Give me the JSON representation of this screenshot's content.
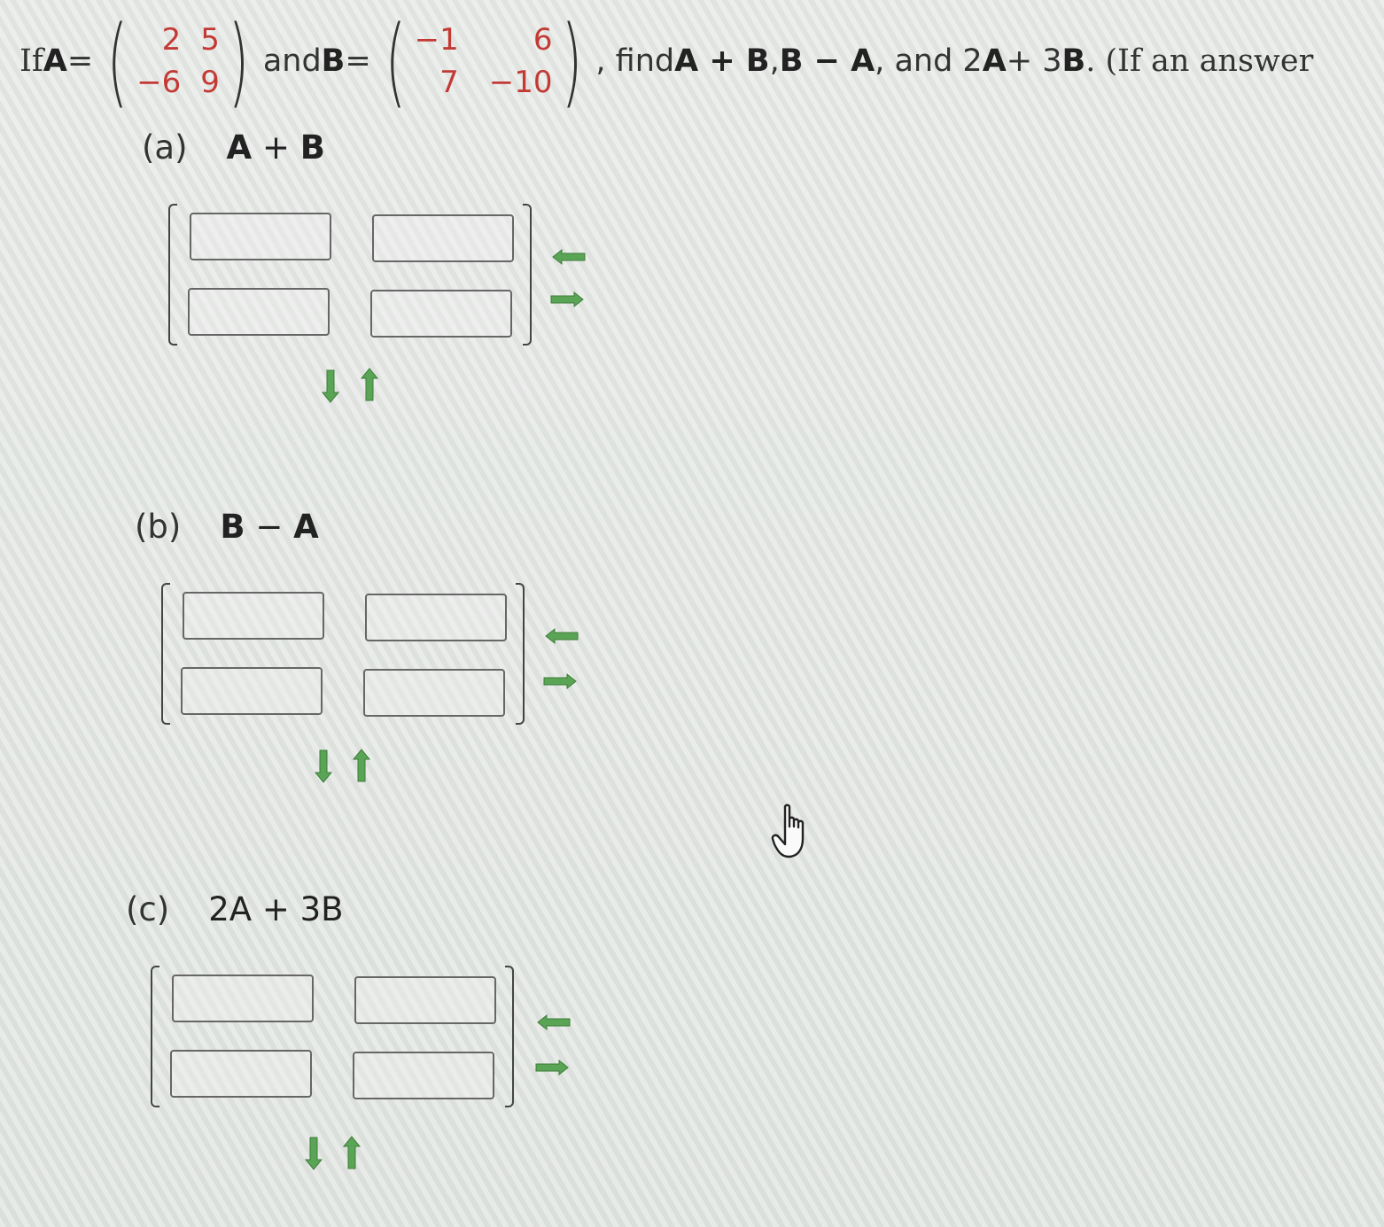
{
  "question": {
    "prefix": "If ",
    "matrix_a_name": "A",
    "equals": " = ",
    "matrix_a": [
      [
        "2",
        "5"
      ],
      [
        "−6",
        "9"
      ]
    ],
    "and_text": " and ",
    "matrix_b_name": "B",
    "matrix_b": [
      [
        "−1",
        "6"
      ],
      [
        "7",
        "−10"
      ]
    ],
    "suffix_find": ", find ",
    "task1": "A + B",
    "sep1": ", ",
    "task2": "B − A",
    "sep2": ", and 2",
    "task3_a": "A",
    "task3_mid": " + 3",
    "task3_b": "B",
    "suffix_end": ". (If an answer"
  },
  "parts": [
    {
      "label": "(a)",
      "expr_parts": [
        "A",
        " + ",
        "B"
      ],
      "cells": [
        [
          "",
          ""
        ],
        [
          "",
          ""
        ]
      ]
    },
    {
      "label": "(b)",
      "expr_parts": [
        "B",
        " − ",
        "A"
      ],
      "cells": [
        [
          "",
          ""
        ],
        [
          "",
          ""
        ]
      ]
    },
    {
      "label": "(c)",
      "expr_parts": [
        "2A",
        " + ",
        "3B"
      ],
      "cells": [
        [
          "",
          ""
        ],
        [
          "",
          ""
        ]
      ]
    }
  ],
  "controls": {
    "remove_column_icon": "arrow-left-icon",
    "add_column_icon": "arrow-right-icon",
    "add_row_icon": "arrow-down-icon",
    "remove_row_icon": "arrow-up-icon"
  },
  "colors": {
    "matrix_entry": "#c33a35",
    "arrow_green": "#4f9a4a"
  }
}
